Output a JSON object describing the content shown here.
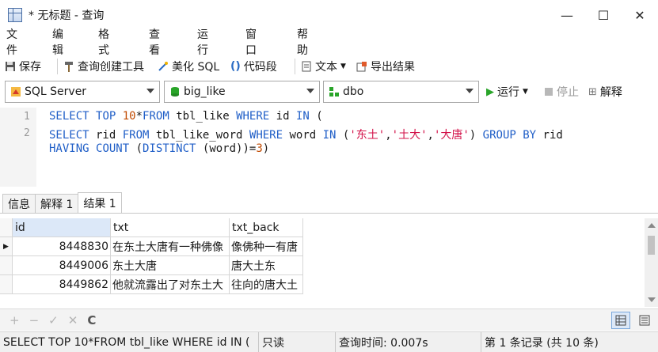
{
  "window": {
    "title": "* 无标题 - 查询",
    "minimize_glyph": "—",
    "maximize_glyph": "☐",
    "close_glyph": "✕"
  },
  "menu": [
    "文件",
    "编辑",
    "格式",
    "查看",
    "运行",
    "窗口",
    "帮助"
  ],
  "toolbar": {
    "save": "保存",
    "query_builder": "查询创建工具",
    "beautify": "美化 SQL",
    "snippet": "代码段",
    "text": "文本",
    "export": "导出结果"
  },
  "connection": {
    "server": "SQL Server",
    "database": "big_like",
    "schema": "dbo",
    "run": "运行",
    "stop": "停止",
    "explain": "解释"
  },
  "editor": {
    "line_numbers": [
      "1",
      "2"
    ]
  },
  "tabs": [
    "信息",
    "解释 1",
    "结果 1"
  ],
  "grid": {
    "columns": [
      "id",
      "txt",
      "txt_back"
    ],
    "rows": [
      [
        "8448830",
        "在东土大唐有一种佛像",
        "像佛种一有唐"
      ],
      [
        "8449006",
        "东土大唐",
        "唐大土东"
      ],
      [
        "8449862",
        "他就流露出了对东土大",
        "往向的唐大土"
      ]
    ]
  },
  "gridbar": {
    "icons": [
      "+",
      "−",
      "✓",
      "✕",
      "C"
    ]
  },
  "status": {
    "sql": "SELECT TOP 10*FROM tbl_like WHERE id IN (",
    "mode": "只读",
    "query_time": "查询时间: 0.007s",
    "records": "第 1 条记录 (共 10 条)"
  },
  "colors": {
    "keyword": "#1f5ec7",
    "number": "#c14a00",
    "string": "#d3134a",
    "run_green": "#2aa52a"
  }
}
